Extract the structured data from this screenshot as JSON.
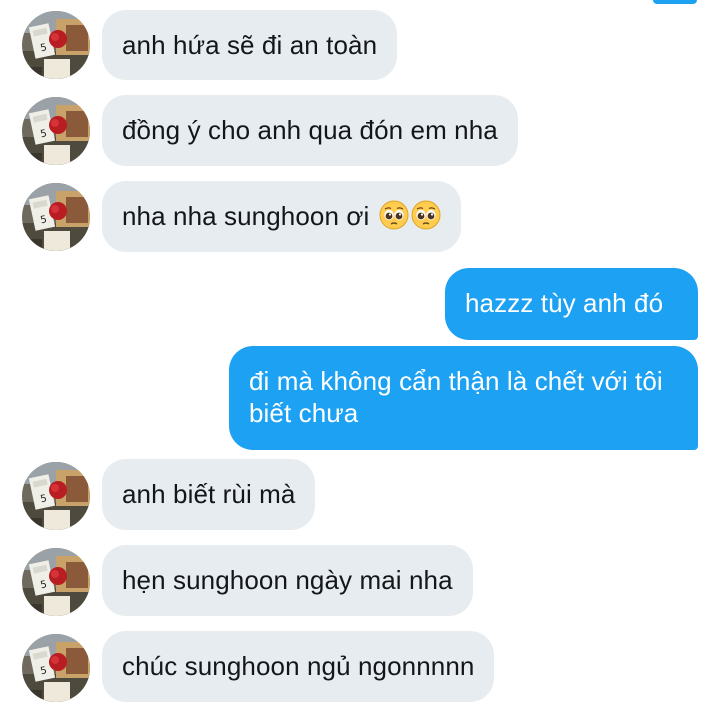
{
  "conversation": {
    "messages": [
      {
        "side": "in",
        "text": "anh hứa sẽ đi an toàn"
      },
      {
        "side": "in",
        "text": "đồng ý cho anh qua đón em nha"
      },
      {
        "side": "in",
        "text": "nha nha sunghoon ơi",
        "emoji": [
          "pleading-face-icon",
          "pleading-face-icon"
        ]
      },
      {
        "side": "out",
        "text": "hazzz tùy anh đó"
      },
      {
        "side": "out",
        "text": "đi mà không cẩn thận là chết với tôi biết chưa"
      },
      {
        "side": "in",
        "text": "anh biết rùi mà"
      },
      {
        "side": "in",
        "text": "hẹn sunghoon ngày mai nha"
      },
      {
        "side": "in",
        "text": "chúc sunghoon ngủ ngonnnnn"
      }
    ]
  },
  "colors": {
    "outgoing_bubble": "#1da1f2",
    "incoming_bubble": "#e7ecf0",
    "incoming_text": "#14171a",
    "outgoing_text": "#ffffff"
  }
}
